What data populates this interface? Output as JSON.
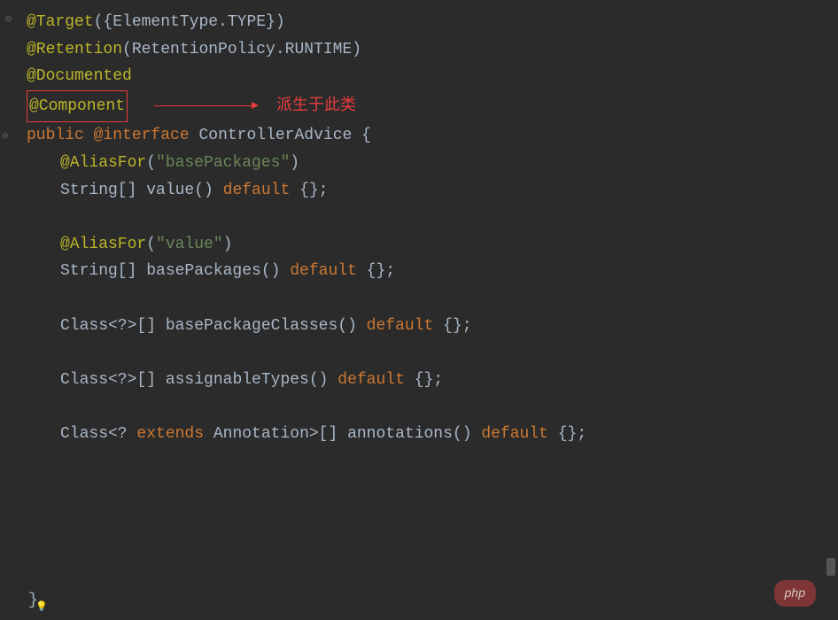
{
  "code": {
    "target_annotation": "@Target",
    "target_param": "({ElementType.TYPE})",
    "retention_annotation": "@Retention",
    "retention_param": "(RetentionPolicy.RUNTIME)",
    "documented_annotation": "@Documented",
    "component_annotation": "@Component",
    "comment_text": "派生于此类",
    "modifier_public": "public",
    "kw_at_interface": "@interface",
    "class_name": "ControllerAdvice",
    "open_brace": " {",
    "aliasfor_annotation": "@AliasFor",
    "alias_value_base": "\"basePackages\"",
    "alias_value_value": "\"value\"",
    "string_array": "String[] ",
    "class_wild": "Class<?>[] ",
    "class_extends_prefix": "Class<? ",
    "kw_extends": "extends",
    "annotation_suffix": " Annotation>[] ",
    "method_value": "value",
    "method_basePackages": "basePackages",
    "method_basePackageClasses": "basePackageClasses",
    "method_assignableTypes": "assignableTypes",
    "method_annotations": "annotations",
    "parens": "() ",
    "kw_default": "default",
    "empty_braces": " {};",
    "closing_brace": "}"
  },
  "watermark": "php"
}
